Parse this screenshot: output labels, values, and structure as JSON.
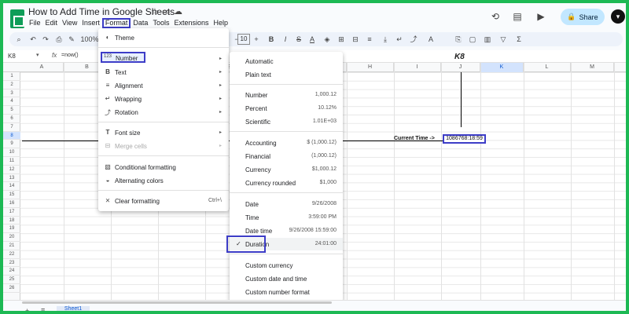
{
  "doc": {
    "title": "How to Add Time in Google Sheets"
  },
  "menubar": [
    "File",
    "Edit",
    "View",
    "Insert",
    "Format",
    "Data",
    "Tools",
    "Extensions",
    "Help"
  ],
  "header": {
    "share_label": "Share"
  },
  "toolbar": {
    "zoom": "100%",
    "font_size": "10"
  },
  "formula_bar": {
    "cell_ref": "K8",
    "fx": "fx",
    "formula": "=now()"
  },
  "columns": [
    "A",
    "B",
    "C",
    "D",
    "E",
    "F",
    "G",
    "H",
    "I",
    "J",
    "K",
    "L",
    "M",
    "N"
  ],
  "rows": [
    "1",
    "2",
    "3",
    "4",
    "5",
    "6",
    "7",
    "8",
    "9",
    "10",
    "11",
    "12",
    "13",
    "14",
    "15",
    "16",
    "17",
    "18",
    "19",
    "20",
    "21",
    "22",
    "23",
    "24",
    "25",
    "26"
  ],
  "annotation": {
    "cell_callout": "K8",
    "label": "Current Time  ->",
    "cell_value": "1086768:18:59"
  },
  "format_menu": {
    "theme": "Theme",
    "number": "Number",
    "text": "Text",
    "alignment": "Alignment",
    "wrapping": "Wrapping",
    "rotation": "Rotation",
    "font_size": "Font size",
    "merge_cells": "Merge cells",
    "conditional": "Conditional formatting",
    "alternating": "Alternating colors",
    "clear": "Clear formatting",
    "clear_shortcut": "Ctrl+\\"
  },
  "number_menu": {
    "automatic": "Automatic",
    "plain_text": "Plain text",
    "items": [
      {
        "label": "Number",
        "example": "1,000.12"
      },
      {
        "label": "Percent",
        "example": "10.12%"
      },
      {
        "label": "Scientific",
        "example": "1.01E+03"
      },
      {
        "label": "Accounting",
        "example": "$ (1,000.12)"
      },
      {
        "label": "Financial",
        "example": "(1,000.12)"
      },
      {
        "label": "Currency",
        "example": "$1,000.12"
      },
      {
        "label": "Currency rounded",
        "example": "$1,000"
      },
      {
        "label": "Date",
        "example": "9/26/2008"
      },
      {
        "label": "Time",
        "example": "3:59:00 PM"
      },
      {
        "label": "Date time",
        "example": "9/26/2008 15:59:00"
      },
      {
        "label": "Duration",
        "example": "24:01:00"
      }
    ],
    "custom_currency": "Custom currency",
    "custom_date_time": "Custom date and time",
    "custom_number": "Custom number format"
  },
  "sheet_tab": "Sheet1"
}
